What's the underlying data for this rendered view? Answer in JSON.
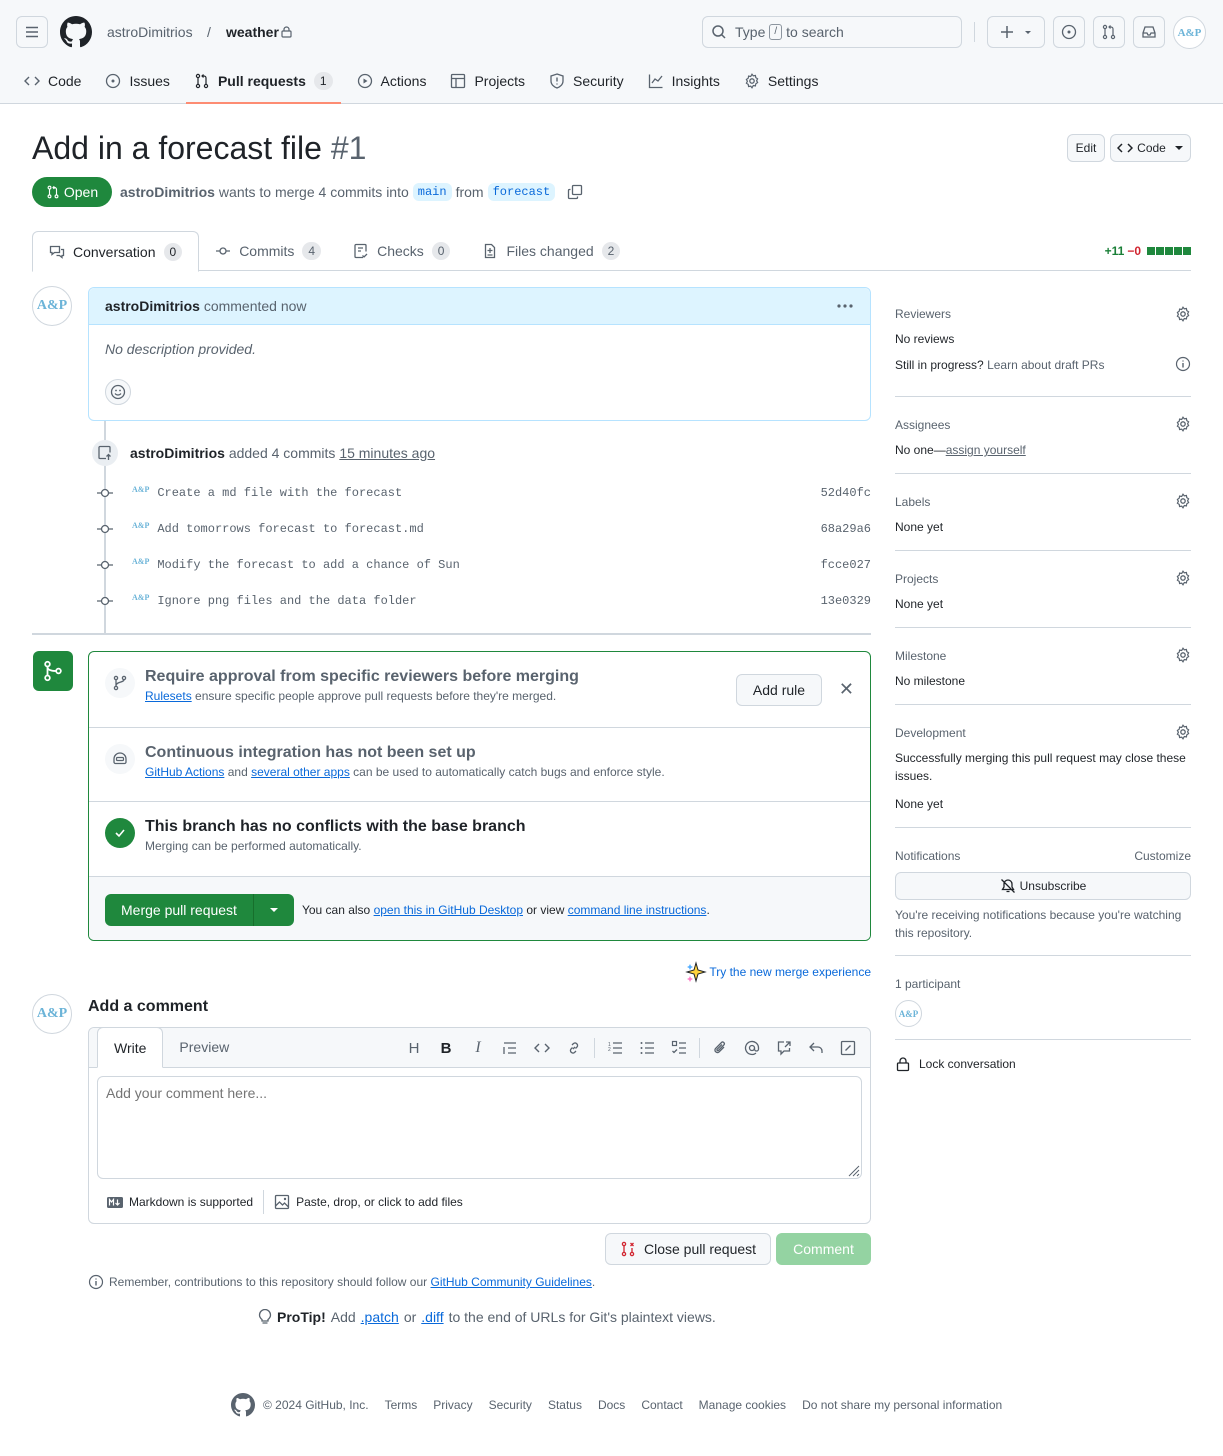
{
  "header": {
    "owner": "astroDimitrios",
    "repo": "weather",
    "search_prefix": "Type",
    "search_key": "/",
    "search_suffix": "to search",
    "avatar_initials": "A&P"
  },
  "nav": [
    {
      "label": "Code",
      "icon": "code-icon"
    },
    {
      "label": "Issues",
      "icon": "issue-icon"
    },
    {
      "label": "Pull requests",
      "icon": "pull-request-icon",
      "count": "1",
      "selected": true
    },
    {
      "label": "Actions",
      "icon": "play-icon"
    },
    {
      "label": "Projects",
      "icon": "table-icon"
    },
    {
      "label": "Security",
      "icon": "shield-icon"
    },
    {
      "label": "Insights",
      "icon": "graph-icon"
    },
    {
      "label": "Settings",
      "icon": "gear-icon"
    }
  ],
  "pr": {
    "title": "Add in a forecast file",
    "number": "#1",
    "edit_label": "Edit",
    "code_label": "Code",
    "state": "Open",
    "author": "astroDimitrios",
    "merge_text": "wants to merge 4 commits into",
    "base": "main",
    "from_text": "from",
    "head": "forecast"
  },
  "tabs": [
    {
      "label": "Conversation",
      "count": "0"
    },
    {
      "label": "Commits",
      "count": "4"
    },
    {
      "label": "Checks",
      "count": "0"
    },
    {
      "label": "Files changed",
      "count": "2"
    }
  ],
  "diffstat": {
    "additions": "+11",
    "deletions": "−0",
    "colors": {
      "add": "#1a7f37",
      "del": "#d1242f"
    }
  },
  "comment": {
    "author": "astroDimitrios",
    "action": "commented now",
    "body": "No description provided."
  },
  "event": {
    "author": "astroDimitrios",
    "text": "added 4 commits",
    "time": "15 minutes ago"
  },
  "commits": [
    {
      "message": "Create a md file with the forecast",
      "sha": "52d40fc"
    },
    {
      "message": "Add tomorrows forecast to forecast.md",
      "sha": "68a29a6"
    },
    {
      "message": "Modify the forecast to add a chance of Sun",
      "sha": "fcce027"
    },
    {
      "message": "Ignore png files and the data folder",
      "sha": "13e0329"
    }
  ],
  "merge": {
    "rule_title": "Require approval from specific reviewers before merging",
    "rule_link": "Rulesets",
    "rule_text": "ensure specific people approve pull requests before they're merged.",
    "add_rule": "Add rule",
    "ci_title": "Continuous integration has not been set up",
    "ci_link1": "GitHub Actions",
    "ci_and": "and",
    "ci_link2": "several other apps",
    "ci_text": "can be used to automatically catch bugs and enforce style.",
    "ok_title": "This branch has no conflicts with the base branch",
    "ok_text": "Merging can be performed automatically.",
    "merge_button": "Merge pull request",
    "also_text": "You can also",
    "desktop_link": "open this in GitHub Desktop",
    "or_view": "or view",
    "cli_link": "command line instructions",
    "period": ".",
    "try_new": "Try the new merge experience"
  },
  "composer": {
    "title": "Add a comment",
    "write_tab": "Write",
    "preview_tab": "Preview",
    "placeholder": "Add your comment here...",
    "markdown_note": "Markdown is supported",
    "attach_note": "Paste, drop, or click to add files",
    "close_pr": "Close pull request",
    "comment_btn": "Comment"
  },
  "remember": {
    "text": "Remember, contributions to this repository should follow our",
    "link": "GitHub Community Guidelines",
    "end": "."
  },
  "protip": {
    "label": "ProTip!",
    "t1": "Add",
    "patch": ".patch",
    "t2": "or",
    "diff": ".diff",
    "t3": "to the end of URLs for Git's plaintext views."
  },
  "sidebar": {
    "reviewers": {
      "title": "Reviewers",
      "value": "No reviews",
      "draft_q": "Still in progress?",
      "draft_link": "Learn about draft PRs"
    },
    "assignees": {
      "title": "Assignees",
      "value": "No one—",
      "link": "assign yourself"
    },
    "labels": {
      "title": "Labels",
      "value": "None yet"
    },
    "projects": {
      "title": "Projects",
      "value": "None yet"
    },
    "milestone": {
      "title": "Milestone",
      "value": "No milestone"
    },
    "development": {
      "title": "Development",
      "desc": "Successfully merging this pull request may close these issues.",
      "value": "None yet"
    },
    "notifications": {
      "title": "Notifications",
      "customize": "Customize",
      "button": "Unsubscribe",
      "reason": "You're receiving notifications because you're watching this repository."
    },
    "participants": {
      "title": "1 participant"
    },
    "lock": "Lock conversation"
  },
  "footer": {
    "copyright": "© 2024 GitHub, Inc.",
    "links": [
      "Terms",
      "Privacy",
      "Security",
      "Status",
      "Docs",
      "Contact",
      "Manage cookies",
      "Do not share my personal information"
    ]
  }
}
